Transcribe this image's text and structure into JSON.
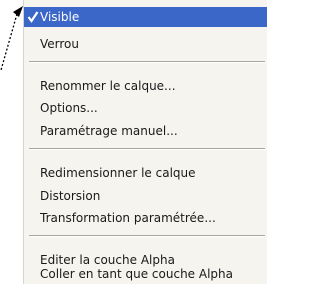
{
  "menu": {
    "items": [
      {
        "label": "Visible",
        "checked": true,
        "highlighted": true
      },
      {
        "label": "Verrou"
      },
      {
        "label": "Renommer le calque..."
      },
      {
        "label": "Options..."
      },
      {
        "label": "Paramétrage manuel..."
      },
      {
        "label": "Redimensionner le calque"
      },
      {
        "label": "Distorsion"
      },
      {
        "label": "Transformation paramétrée..."
      },
      {
        "label": "Editer la couche Alpha"
      },
      {
        "label": "Coller en tant que couche Alpha"
      }
    ]
  },
  "colors": {
    "highlight": "#3a67c8",
    "menu_background": "#f5f4ef",
    "separator": "#a9a79c"
  },
  "icons": {
    "pointer": "arrow-pointer-icon",
    "check": "check-icon"
  }
}
